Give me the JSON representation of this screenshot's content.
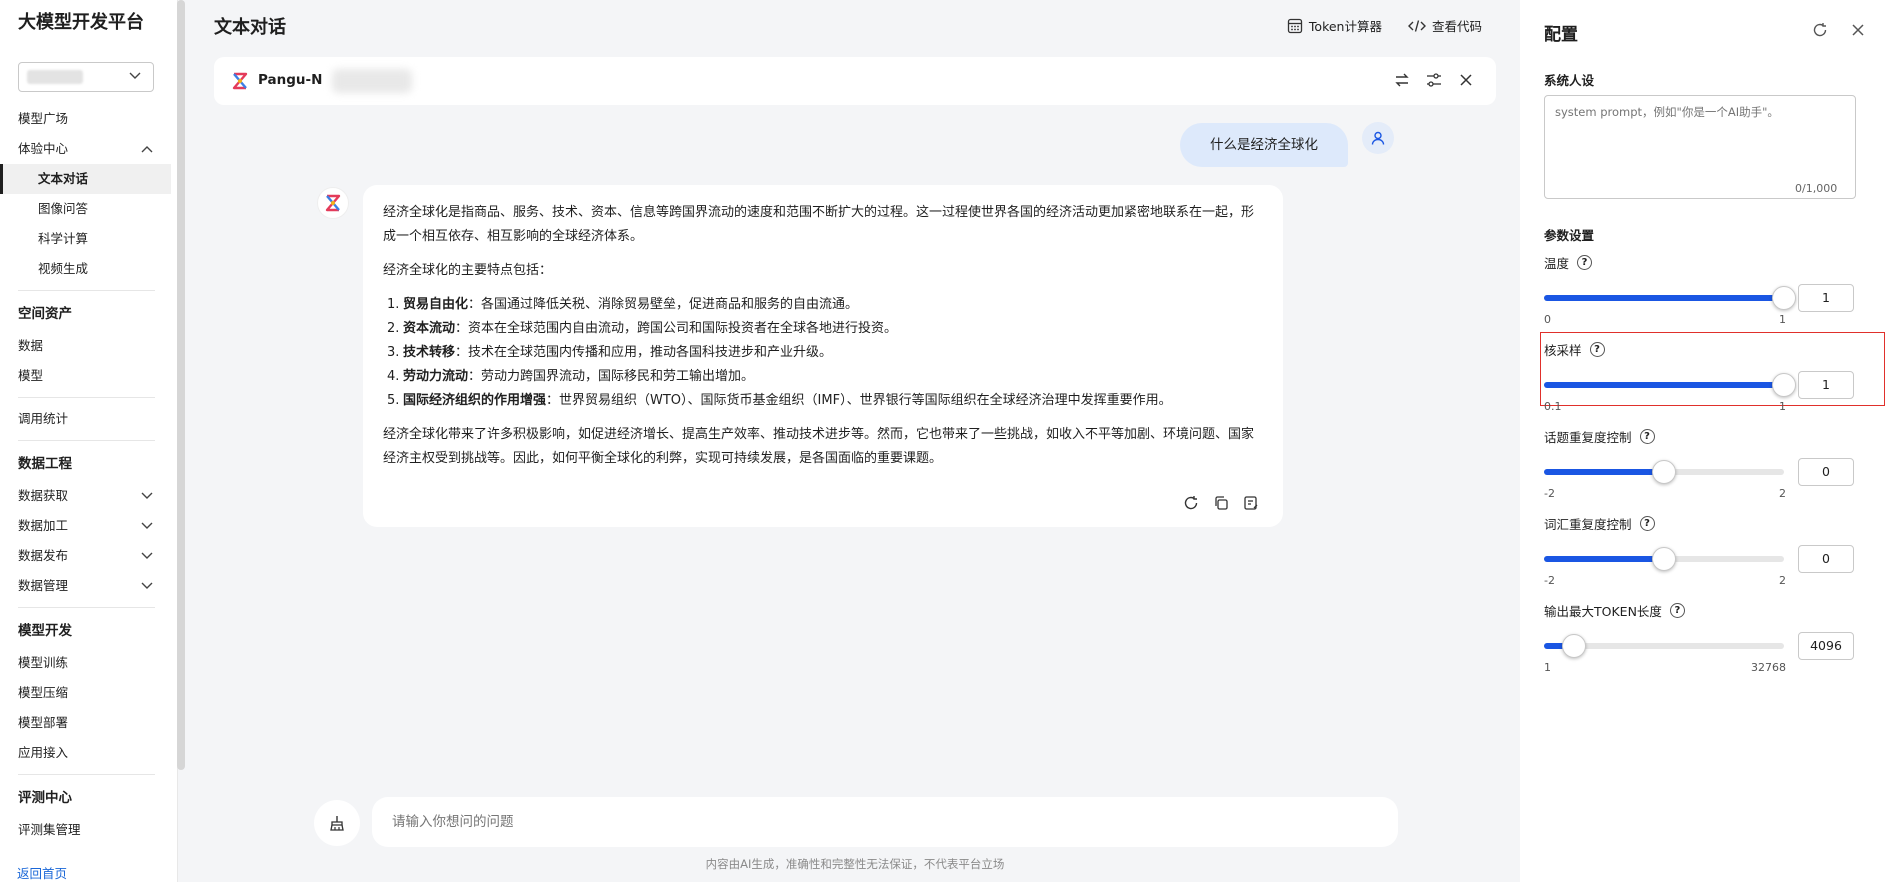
{
  "sidebar": {
    "brand": "大模型开发平台",
    "items": {
      "model_square": "模型广场",
      "experience_center": "体验中心",
      "text_chat": "文本对话",
      "image_qa": "图像问答",
      "science_calc": "科学计算",
      "video_gen": "视频生成",
      "space_assets": "空间资产",
      "data": "数据",
      "model": "模型",
      "call_stats": "调用统计",
      "data_engineering": "数据工程",
      "data_acquire": "数据获取",
      "data_process": "数据加工",
      "data_publish": "数据发布",
      "data_manage": "数据管理",
      "model_dev": "模型开发",
      "model_train": "模型训练",
      "model_compress": "模型压缩",
      "model_deploy": "模型部署",
      "app_access": "应用接入",
      "eval_center": "评测中心",
      "eval_set_manage": "评测集管理"
    },
    "back_home": "返回首页"
  },
  "header": {
    "title": "文本对话",
    "token_calc": "Token计算器",
    "view_code": "查看代码"
  },
  "model_bar": {
    "model_name": "Pangu-N"
  },
  "chat": {
    "user_message": "什么是经济全球化",
    "bot": {
      "intro": "经济全球化是指商品、服务、技术、资本、信息等跨国界流动的速度和范围不断扩大的过程。这一过程使世界各国的经济活动更加紧密地联系在一起，形成一个相互依存、相互影响的全球经济体系。",
      "features_title": "经济全球化的主要特点包括：",
      "features": [
        {
          "num": "1.",
          "title": "贸易自由化",
          "text": "：各国通过降低关税、消除贸易壁垒，促进商品和服务的自由流通。"
        },
        {
          "num": "2.",
          "title": "资本流动",
          "text": "：资本在全球范围内自由流动，跨国公司和国际投资者在全球各地进行投资。"
        },
        {
          "num": "3.",
          "title": "技术转移",
          "text": "：技术在全球范围内传播和应用，推动各国科技进步和产业升级。"
        },
        {
          "num": "4.",
          "title": "劳动力流动",
          "text": "：劳动力跨国界流动，国际移民和劳工输出增加。"
        },
        {
          "num": "5.",
          "title": "国际经济组织的作用增强",
          "text": "：世界贸易组织（WTO）、国际货币基金组织（IMF）、世界银行等国际组织在全球经济治理中发挥重要作用。"
        }
      ],
      "conclusion": "经济全球化带来了许多积极影响，如促进经济增长、提高生产效率、推动技术进步等。然而，它也带来了一些挑战，如收入不平等加剧、环境问题、国家经济主权受到挑战等。因此，如何平衡全球化的利弊，实现可持续发展，是各国面临的重要课题。"
    },
    "input_placeholder": "请输入你想问的问题",
    "disclaimer": "内容由AI生成，准确性和完整性无法保证，不代表平台立场"
  },
  "config": {
    "title": "配置",
    "system_persona_label": "系统人设",
    "system_prompt_placeholder": "system prompt，例如\"你是一个AI助手\"。",
    "char_counter": "0/1,000",
    "params_section": "参数设置",
    "params": [
      {
        "label": "温度",
        "value": "1",
        "min": "0",
        "max": "1",
        "level": 1.0
      },
      {
        "label": "核采样",
        "value": "1",
        "min": "0.1",
        "max": "1",
        "level": 1.0
      },
      {
        "label": "话题重复度控制",
        "value": "0",
        "min": "-2",
        "max": "2",
        "level": 0.5
      },
      {
        "label": "词汇重复度控制",
        "value": "0",
        "min": "-2",
        "max": "2",
        "level": 0.5
      },
      {
        "label": "输出最大TOKEN长度",
        "value": "4096",
        "min": "1",
        "max": "32768",
        "level": 0.125
      }
    ],
    "accent_color": "#1a56e3",
    "highlight_color": "#e0302b"
  }
}
